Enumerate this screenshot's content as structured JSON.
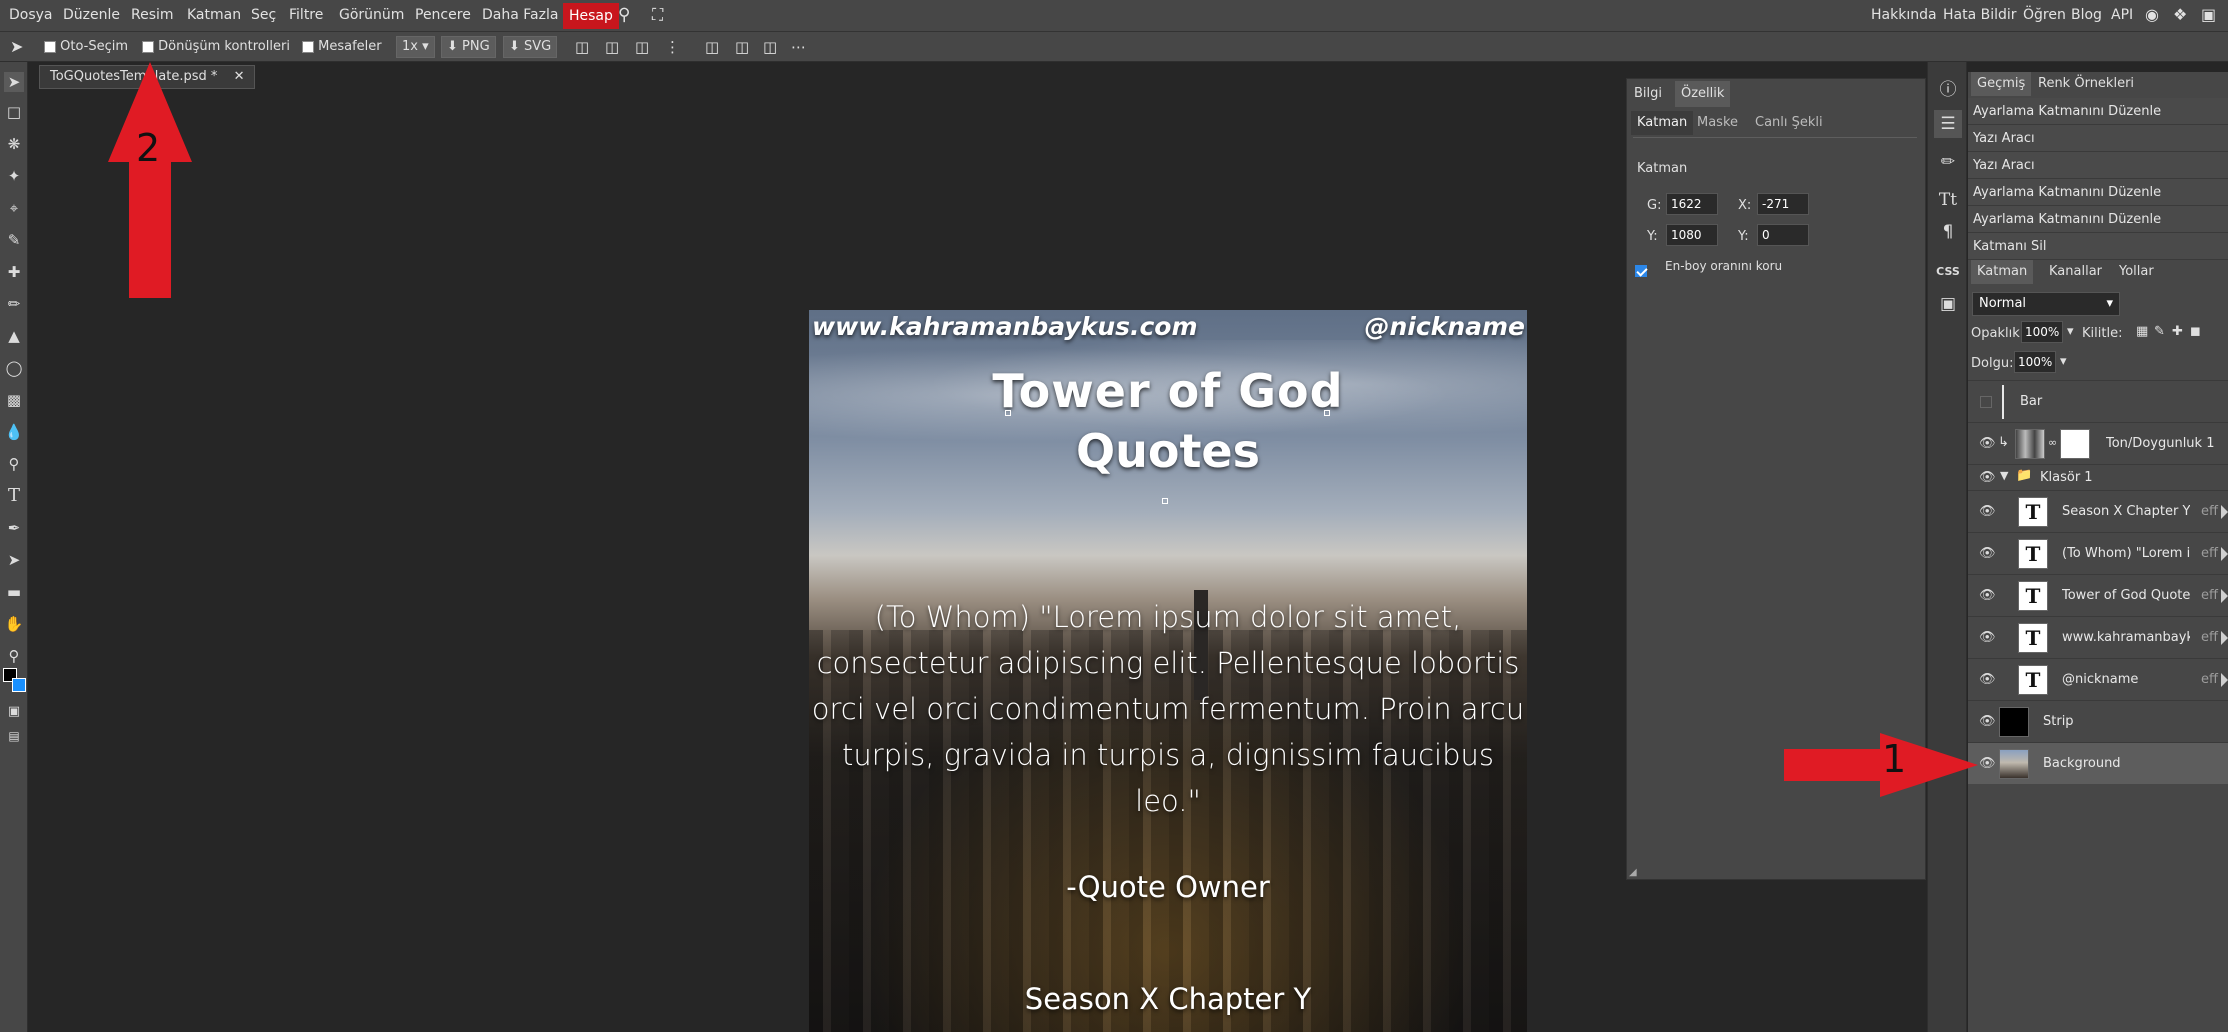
{
  "menu": {
    "items": [
      "Dosya",
      "Düzenle",
      "Resim",
      "Katman",
      "Seç",
      "Filtre",
      "Görünüm",
      "Pencere",
      "Daha Fazla"
    ],
    "hesap": "Hesap",
    "right_items": [
      "Hakkında",
      "Hata Bildir",
      "Öğren",
      "Blog",
      "API"
    ]
  },
  "options": {
    "oto_secim": "Oto-Seçim",
    "donusum": "Dönüşüm kontrolleri",
    "mesafeler": "Mesafeler",
    "zoom": "1x",
    "png": "PNG",
    "svg": "SVG"
  },
  "document": {
    "tab_label": "ToGQuotesTemplate.psd *",
    "close": "✕"
  },
  "canvas": {
    "url": "www.kahramanbaykus.com",
    "nickname": "@nickname",
    "title_line1": "Tower of God",
    "title_line2": "Quotes",
    "quote_lines": [
      "(To Whom) \"Lorem ipsum dolor sit amet,",
      "consectetur adipiscing elit. Pellentesque lobortis",
      "orci vel orci condimentum fermentum. Proin arcu",
      "turpis, gravida in turpis a, dignissim faucibus leo.\""
    ],
    "owner": "-Quote Owner",
    "season": "Season X Chapter Y"
  },
  "properties": {
    "tabs": [
      "Bilgi",
      "Özellik"
    ],
    "subtabs": [
      "Katman",
      "Maske",
      "Canlı Şekli"
    ],
    "section": "Katman",
    "g_label": "G:",
    "g_value": "1622",
    "x_label": "X:",
    "x_value": "-271",
    "y_label": "Y:",
    "y_value": "1080",
    "y2_label": "Y:",
    "y2_value": "0",
    "aspect": "En-boy oranını koru"
  },
  "history": {
    "tabs": [
      "Geçmiş",
      "Renk Örnekleri"
    ],
    "items": [
      "Ayarlama Katmanını Düzenle",
      "Yazı Aracı",
      "Yazı Aracı",
      "Ayarlama Katmanını Düzenle",
      "Ayarlama Katmanını Düzenle",
      "Katmanı Sil"
    ]
  },
  "layers": {
    "tabs": [
      "Katman",
      "Kanallar",
      "Yollar"
    ],
    "blend": "Normal",
    "opacity_label": "Opaklık:",
    "opacity": "100%",
    "lock_label": "Kilitle:",
    "fill_label": "Dolgu:",
    "fill": "100%",
    "list": [
      {
        "name": "Bar"
      },
      {
        "name": "Ton/Doygunluk 1"
      },
      {
        "name": "Klasör 1"
      },
      {
        "name": "Season X Chapter Y",
        "eff": "eff"
      },
      {
        "name": "(To Whom) \"Lorem ip",
        "eff": "eff"
      },
      {
        "name": "Tower of God Quotes",
        "eff": "eff"
      },
      {
        "name": "www.kahramanbayk",
        "eff": "eff"
      },
      {
        "name": "@nickname",
        "eff": "eff"
      },
      {
        "name": "Strip"
      },
      {
        "name": "Background"
      }
    ]
  },
  "annotations": {
    "arrow1": "1",
    "arrow2": "2"
  },
  "colors": {
    "accent_red": "#e01b24",
    "hesap": "#c8161d",
    "panel": "#474747",
    "workspace": "#262626"
  }
}
